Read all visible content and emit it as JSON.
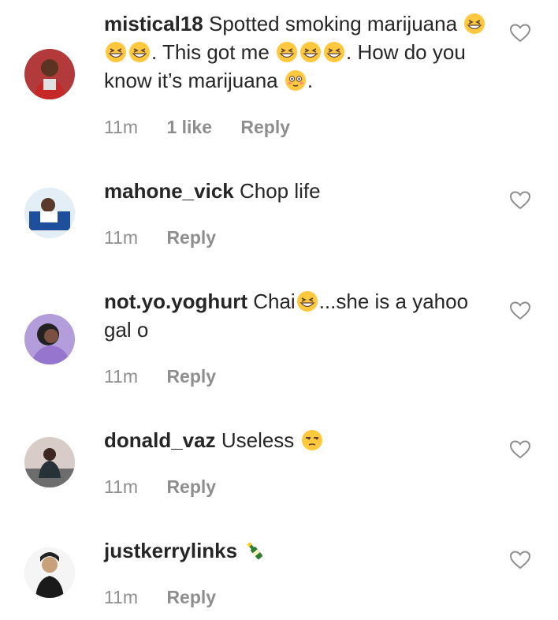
{
  "comments": [
    {
      "username": "mistical18",
      "text_parts": [
        "Spotted smoking marijuana ",
        ". This got me ",
        ". How do you know it’s marijuana ",
        "."
      ],
      "time": "11m",
      "likes": "1 like",
      "reply": "Reply",
      "emojis": [
        "grinning-squint-face",
        "grinning-squint-face",
        "grinning-squint-face",
        "grinning-squint-face",
        "grinning-squint-face",
        "grinning-squint-face",
        "flushed-face"
      ]
    },
    {
      "username": "mahone_vick",
      "text": "Chop life",
      "time": "11m",
      "reply": "Reply"
    },
    {
      "username": "not.yo.yoghurt",
      "text_parts": [
        "Chai",
        "...she is a yahoo gal o"
      ],
      "time": "11m",
      "reply": "Reply",
      "emojis": [
        "grinning-squint-face"
      ]
    },
    {
      "username": "donald_vaz",
      "text": "Useless",
      "time": "11m",
      "reply": "Reply",
      "emojis": [
        "unamused-face"
      ]
    },
    {
      "username": "justkerrylinks",
      "text": "",
      "time": "11m",
      "reply": "Reply",
      "emojis": [
        "champagne-bottle"
      ]
    }
  ],
  "icons": {
    "like": "heart-outline-icon"
  },
  "colors": {
    "text": "#262626",
    "meta": "#8e8e8e",
    "emoji": "#ffc83d"
  }
}
